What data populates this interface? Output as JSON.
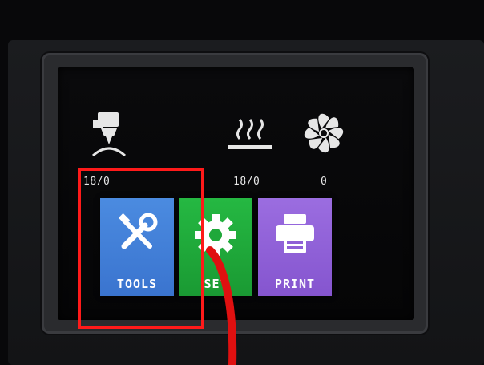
{
  "status": {
    "nozzle_temp": "18/0",
    "bed_temp": "18/0",
    "fan_speed": "0"
  },
  "menu": {
    "tools": {
      "label": "TOOLS",
      "color": "#3f7fd6",
      "icon": "tools-icon"
    },
    "set": {
      "label": "SET",
      "color": "#1fa83a",
      "icon": "gear-icon"
    },
    "print": {
      "label": "PRINT",
      "color": "#8e5fd6",
      "icon": "printer-icon"
    }
  },
  "annotation": {
    "highlight_color": "#ff1a1a",
    "arrow_color": "#e01010"
  }
}
